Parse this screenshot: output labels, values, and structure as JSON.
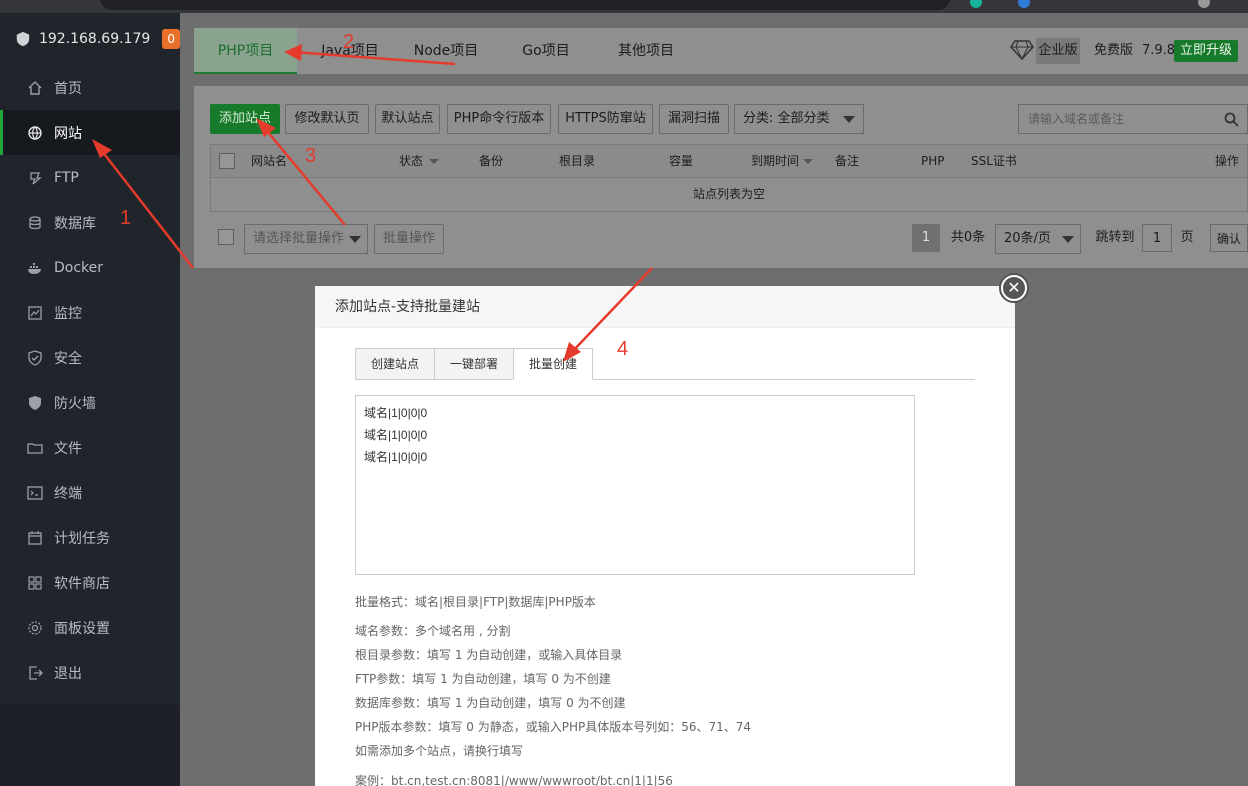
{
  "server": {
    "ip": "192.168.69.179",
    "badge": "0"
  },
  "sidebar": {
    "items": [
      {
        "label": "首页",
        "icon": "home-icon"
      },
      {
        "label": "网站",
        "icon": "globe-icon",
        "active": true
      },
      {
        "label": "FTP",
        "icon": "ftp-icon"
      },
      {
        "label": "数据库",
        "icon": "database-icon"
      },
      {
        "label": "Docker",
        "icon": "docker-icon"
      },
      {
        "label": "监控",
        "icon": "monitor-icon"
      },
      {
        "label": "安全",
        "icon": "shield-icon"
      },
      {
        "label": "防火墙",
        "icon": "firewall-icon"
      },
      {
        "label": "文件",
        "icon": "folder-icon"
      },
      {
        "label": "终端",
        "icon": "terminal-icon"
      },
      {
        "label": "计划任务",
        "icon": "calendar-icon"
      },
      {
        "label": "软件商店",
        "icon": "grid-icon"
      },
      {
        "label": "面板设置",
        "icon": "gear-icon"
      },
      {
        "label": "退出",
        "icon": "logout-icon"
      }
    ]
  },
  "tabs": [
    "PHP项目",
    "Java项目",
    "Node项目",
    "Go项目",
    "其他项目"
  ],
  "edition": {
    "enterprise": "企业版",
    "free": "免费版",
    "version": "7.9.8",
    "upgrade": "立即升级"
  },
  "toolbar": {
    "add_site": "添加站点",
    "modify_default": "修改默认页",
    "default_site": "默认站点",
    "php_cli": "PHP命令行版本",
    "https_guard": "HTTPS防窜站",
    "vuln_scan": "漏洞扫描",
    "category": "分类: 全部分类",
    "search_placeholder": "请输入域名或备注"
  },
  "table": {
    "columns": [
      "网站名",
      "状态",
      "备份",
      "根目录",
      "容量",
      "到期时间",
      "备注",
      "PHP",
      "SSL证书",
      "操作"
    ],
    "empty": "站点列表为空"
  },
  "footer": {
    "batch_select": "请选择批量操作",
    "batch_btn": "批量操作",
    "page": "1",
    "total": "共0条",
    "per_page": "20条/页",
    "jump_label": "跳转到",
    "jump_value": "1",
    "page_unit": "页",
    "confirm": "确认"
  },
  "modal": {
    "title": "添加站点-支持批量建站",
    "tabs": [
      "创建站点",
      "一键部署",
      "批量创建"
    ],
    "batch_text": [
      "域名|1|0|0|0",
      "域名|1|0|0|0",
      "域名|1|0|0|0"
    ],
    "help": [
      "批量格式：域名|根目录|FTP|数据库|PHP版本",
      "域名参数：多个域名用 , 分割",
      "根目录参数：填写 1 为自动创建，或输入具体目录",
      "FTP参数：填写 1 为自动创建，填写 0 为不创建",
      "数据库参数：填写 1 为自动创建，填写 0 为不创建",
      "PHP版本参数：填写 0 为静态，或输入PHP具体版本号列如：56、71、74",
      "如需添加多个站点，请换行填写",
      "案例：bt.cn,test.cn:8081|/www/wwwroot/bt.cn|1|1|56"
    ]
  },
  "annotations": [
    "1",
    "2",
    "3",
    "4"
  ],
  "colors": {
    "accent": "#20a53a",
    "annotation": "#e53b2c",
    "sidebar": "#20252b"
  }
}
